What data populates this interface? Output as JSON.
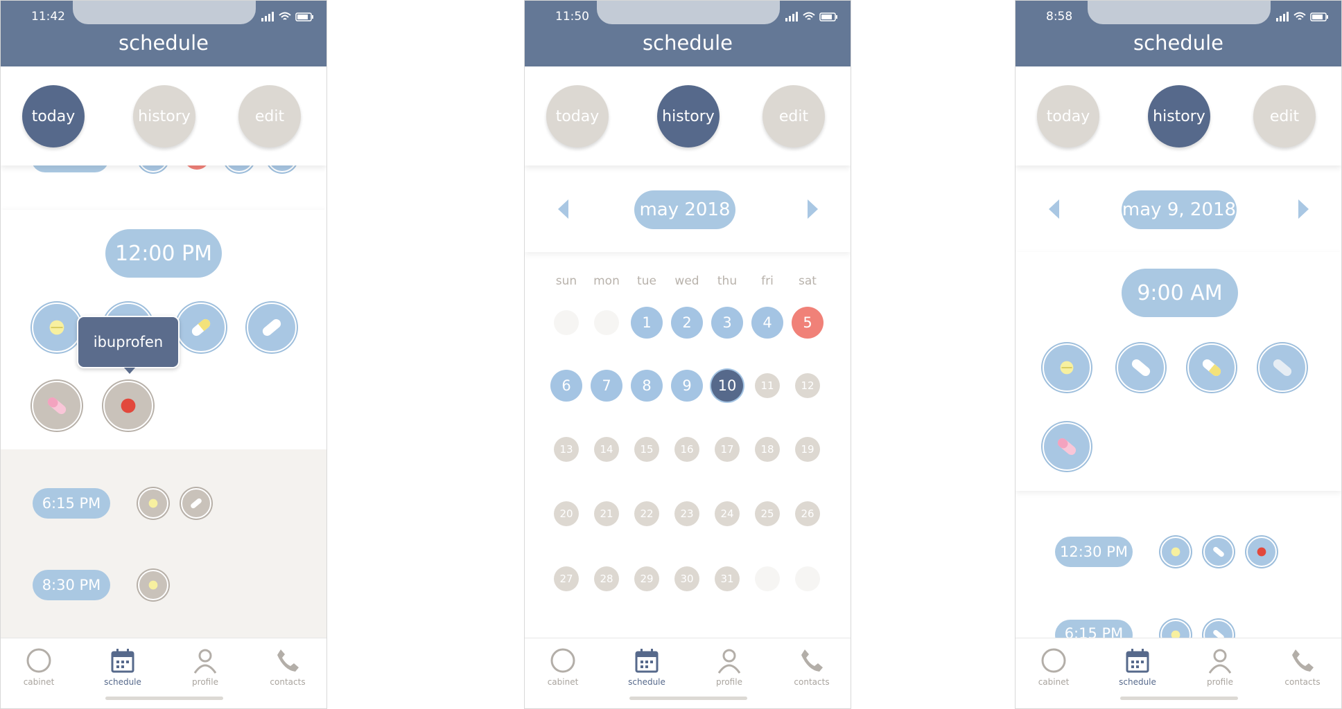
{
  "colors": {
    "header": "#647896",
    "accent_blue": "#a9c7e3",
    "dark_blue": "#56698b",
    "grey": "#dcd8d2",
    "red": "#f08178"
  },
  "screen1": {
    "status_time": "11:42",
    "title": "schedule",
    "tabs": [
      "today",
      "history",
      "edit"
    ],
    "active_tab": "today",
    "time_slot": "12:00 PM",
    "tooltip": "ibuprofen",
    "later_slots": [
      "6:15 PM",
      "8:30 PM"
    ]
  },
  "screen2": {
    "status_time": "11:50",
    "title": "schedule",
    "tabs": [
      "today",
      "history",
      "edit"
    ],
    "active_tab": "history",
    "month": "may 2018",
    "weekdays": [
      "sun",
      "mon",
      "tue",
      "wed",
      "thu",
      "fri",
      "sat"
    ],
    "days": [
      "1",
      "2",
      "3",
      "4",
      "5",
      "6",
      "7",
      "8",
      "9",
      "10",
      "11",
      "12",
      "13",
      "14",
      "15",
      "16",
      "17",
      "18",
      "19",
      "20",
      "21",
      "22",
      "23",
      "24",
      "25",
      "26",
      "27",
      "28",
      "29",
      "30",
      "31"
    ],
    "selected_day": "10",
    "missed_day": "5"
  },
  "screen3": {
    "status_time": "8:58",
    "title": "schedule",
    "tabs": [
      "today",
      "history",
      "edit"
    ],
    "active_tab": "history",
    "date": "may 9, 2018",
    "time_slot": "9:00 AM",
    "later_slots": [
      "12:30 PM",
      "6:15 PM"
    ]
  },
  "nav": {
    "items": [
      "cabinet",
      "schedule",
      "profile",
      "contacts"
    ],
    "active": "schedule",
    "icons": [
      "circle-icon",
      "calendar-icon",
      "person-icon",
      "phone-icon"
    ]
  }
}
